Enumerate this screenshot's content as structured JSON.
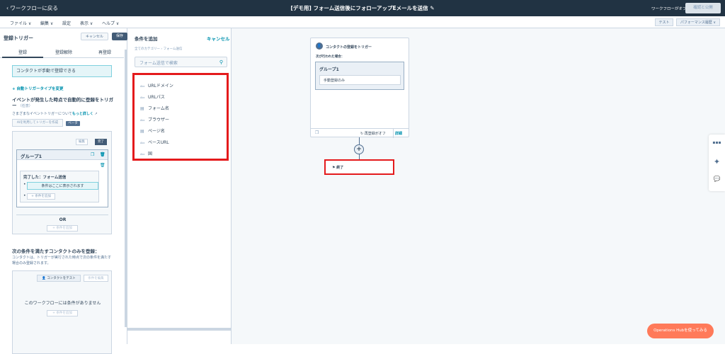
{
  "topbar": {
    "back": "‹ ワークフローに戻る",
    "title": "[デモ用] フォーム送信後にフォローアップEメールを送信",
    "workflow_status": "ワークフローがオフ",
    "review_publish": "確認と公開"
  },
  "menu": {
    "file": "ファイル ∨",
    "edit": "編集 ∨",
    "settings": "設定",
    "view": "表示 ∨",
    "help": "ヘルプ ∨",
    "test": "テスト",
    "performance": "パフォーマンス履歴 ∨"
  },
  "left": {
    "header": "登録トリガー",
    "cancel": "キャンセル",
    "save": "保存",
    "tabs": [
      "登録",
      "登録解除",
      "再登録"
    ],
    "manual_enroll": "コンタクトが手動で登録できる",
    "change_trigger": "+ 自動トリガータイプを変更",
    "event_heading": "イベントが発生した時点で自動的に登録をトリガー",
    "optional": "（任意）",
    "event_sub_prefix": "さまざまなイベントトリガーについて",
    "event_sub_link": "もっと詳しく",
    "ai_button": "AIを利用してトリガーを作成",
    "beta": "ベータ",
    "edit": "編集",
    "done": "完了",
    "group_title": "グループ1",
    "completed": "完了した：フォーム送信",
    "placeholder": "条件はここに表示されます",
    "add_filter": "+ 条件を追加",
    "or": "OR",
    "add_condition": "+ 条件を追加",
    "section2_title": "次の条件を満たすコンタクトのみを登録：",
    "section2_desc": "コンタクトは、トリガーが実行された時点で次の条件を満たす場合のみ登録されます。",
    "test_contact": "コンタクトをテスト",
    "edit_conditions": "条件を編集",
    "no_conditions": "このワークフローには条件がありません",
    "add_condition2": "+ 条件を追加"
  },
  "middle": {
    "header": "条件を追加",
    "cancel": "キャンセル",
    "breadcrumb": "全てのカテゴリー › フォーム送信",
    "search_placeholder": "フォーム送信で検索",
    "items": [
      {
        "type": "Abc",
        "label": "URLドメイン"
      },
      {
        "type": "Abc",
        "label": "URLパス"
      },
      {
        "type": "icon",
        "label": "フォーム名"
      },
      {
        "type": "Abc",
        "label": "ブラウザー"
      },
      {
        "type": "icon",
        "label": "ページ名"
      },
      {
        "type": "Abc",
        "label": "ベースURL"
      },
      {
        "type": "Abc",
        "label": "国"
      }
    ]
  },
  "canvas": {
    "trigger_title": "コンタクトの登録をトリガー",
    "when": "次が行われた場合：",
    "group": "グループ1",
    "manual_only": "手動登録のみ",
    "reenroll": "再登録がオフ",
    "details": "詳細",
    "end": "終了"
  },
  "ops_button": "Operations Hubを使ってみる"
}
